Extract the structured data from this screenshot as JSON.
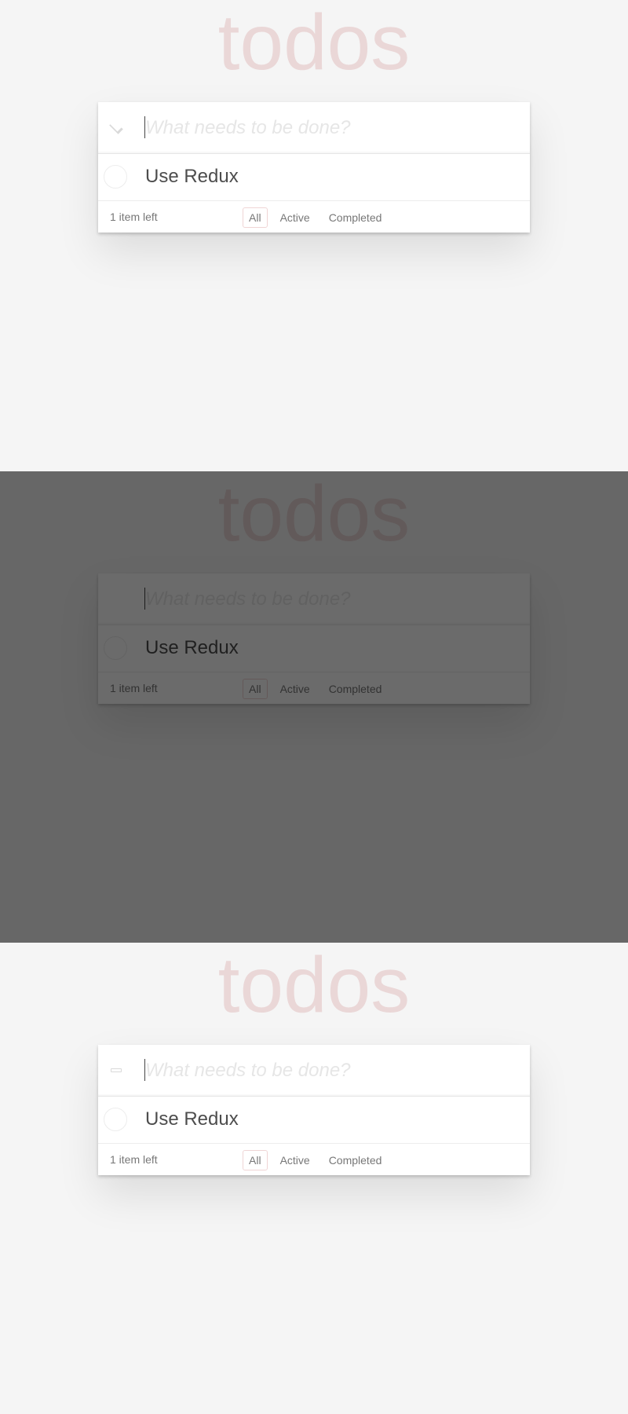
{
  "app": {
    "title": "todos",
    "new_todo_placeholder": "What needs to be done?",
    "todos": [
      {
        "label": "Use Redux",
        "completed": false
      }
    ],
    "footer": {
      "count_text": "1 item left",
      "filters": [
        "All",
        "Active",
        "Completed"
      ],
      "selected_filter": "All"
    }
  },
  "frames": [
    {
      "toggle_icon": "chevron-down-icon",
      "dimmed": false
    },
    {
      "toggle_icon": "pointer-grab-icon",
      "dimmed": true
    },
    {
      "toggle_icon": "dash-icon",
      "dimmed": false
    }
  ],
  "colors": {
    "background": "#f5f5f5",
    "title": "#e6d5d5",
    "accent": "#af2f2f"
  }
}
